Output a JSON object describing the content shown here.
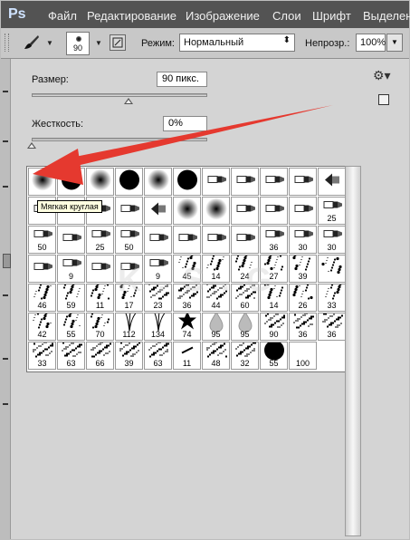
{
  "menubar": {
    "logo": "Ps",
    "items": [
      "Файл",
      "Редактирование",
      "Изображение",
      "Слои",
      "Шрифт",
      "Выделен"
    ]
  },
  "options": {
    "brush_size_value": "90",
    "mode_label": "Режим:",
    "mode_value": "Нормальный",
    "opacity_label": "Непрозр.:",
    "opacity_value": "100%"
  },
  "brush_panel": {
    "size_label": "Размер:",
    "size_value": "90 пикс.",
    "size_level_fraction": 0.55,
    "hardness_label": "Жесткость:",
    "hardness_value": "0%",
    "hardness_level_fraction": 0.0,
    "tooltip": "Мягкая круглая"
  },
  "brushes": [
    {
      "kind": "soft-round",
      "label": ""
    },
    {
      "kind": "hard-round",
      "label": ""
    },
    {
      "kind": "soft-round",
      "label": ""
    },
    {
      "kind": "hard-round",
      "label": ""
    },
    {
      "kind": "soft-round",
      "label": ""
    },
    {
      "kind": "hard-round",
      "label": ""
    },
    {
      "kind": "tip",
      "label": ""
    },
    {
      "kind": "tip",
      "label": ""
    },
    {
      "kind": "tip",
      "label": ""
    },
    {
      "kind": "tip",
      "label": ""
    },
    {
      "kind": "fan",
      "label": ""
    },
    {
      "kind": "tip",
      "label": ""
    },
    {
      "kind": "tip",
      "label": ""
    },
    {
      "kind": "tip",
      "label": ""
    },
    {
      "kind": "tip",
      "label": ""
    },
    {
      "kind": "fan",
      "label": ""
    },
    {
      "kind": "soft-round",
      "label": ""
    },
    {
      "kind": "soft-round",
      "label": ""
    },
    {
      "kind": "tip",
      "label": ""
    },
    {
      "kind": "tip",
      "label": ""
    },
    {
      "kind": "tip",
      "label": ""
    },
    {
      "kind": "tip",
      "label": "25"
    },
    {
      "kind": "tip",
      "label": "50"
    },
    {
      "kind": "tip",
      "label": ""
    },
    {
      "kind": "tip",
      "label": "25"
    },
    {
      "kind": "tip",
      "label": "50"
    },
    {
      "kind": "tip",
      "label": ""
    },
    {
      "kind": "tip",
      "label": ""
    },
    {
      "kind": "tip",
      "label": ""
    },
    {
      "kind": "tip",
      "label": ""
    },
    {
      "kind": "tip",
      "label": "36"
    },
    {
      "kind": "tip",
      "label": "30"
    },
    {
      "kind": "tip",
      "label": "30"
    },
    {
      "kind": "tip",
      "label": ""
    },
    {
      "kind": "tip",
      "label": "9"
    },
    {
      "kind": "tip",
      "label": ""
    },
    {
      "kind": "tip",
      "label": ""
    },
    {
      "kind": "tip",
      "label": "9"
    },
    {
      "kind": "scatter",
      "label": "45"
    },
    {
      "kind": "scatter",
      "label": "14"
    },
    {
      "kind": "scatter",
      "label": "24"
    },
    {
      "kind": "scatter",
      "label": "27"
    },
    {
      "kind": "scatter",
      "label": "39"
    },
    {
      "kind": "scatter",
      "label": ""
    },
    {
      "kind": "scatter",
      "label": "46"
    },
    {
      "kind": "scatter",
      "label": "59"
    },
    {
      "kind": "scatter",
      "label": "11"
    },
    {
      "kind": "scatter",
      "label": "17"
    },
    {
      "kind": "texture",
      "label": "23"
    },
    {
      "kind": "texture",
      "label": "36"
    },
    {
      "kind": "texture",
      "label": "44"
    },
    {
      "kind": "texture",
      "label": "60"
    },
    {
      "kind": "scatter",
      "label": "14"
    },
    {
      "kind": "scatter",
      "label": "26"
    },
    {
      "kind": "scatter",
      "label": "33"
    },
    {
      "kind": "scatter",
      "label": "42"
    },
    {
      "kind": "scatter",
      "label": "55"
    },
    {
      "kind": "scatter",
      "label": "70"
    },
    {
      "kind": "grass",
      "label": "112"
    },
    {
      "kind": "grass",
      "label": "134"
    },
    {
      "kind": "leaf",
      "label": "74"
    },
    {
      "kind": "drop",
      "label": "95"
    },
    {
      "kind": "drop",
      "label": "95"
    },
    {
      "kind": "texture",
      "label": "90"
    },
    {
      "kind": "texture",
      "label": "36"
    },
    {
      "kind": "texture",
      "label": "36"
    },
    {
      "kind": "texture",
      "label": "33"
    },
    {
      "kind": "texture",
      "label": "63"
    },
    {
      "kind": "texture",
      "label": "66"
    },
    {
      "kind": "texture",
      "label": "39"
    },
    {
      "kind": "texture",
      "label": "63"
    },
    {
      "kind": "stroke",
      "label": "11"
    },
    {
      "kind": "texture",
      "label": "48"
    },
    {
      "kind": "texture",
      "label": "32"
    },
    {
      "kind": "hard-round",
      "label": "55"
    },
    {
      "kind": "empty",
      "label": "100"
    }
  ],
  "colors": {
    "menubar": "#535353",
    "panel": "#d4d4d4",
    "arrow": "#e5392f",
    "tooltip_bg": "#ffffe1"
  },
  "icons": {
    "gear": "gear-icon",
    "new_preset": "new-preset-icon",
    "brush_tool": "brush-tool-icon",
    "panel_toggle": "brush-panel-icon"
  }
}
